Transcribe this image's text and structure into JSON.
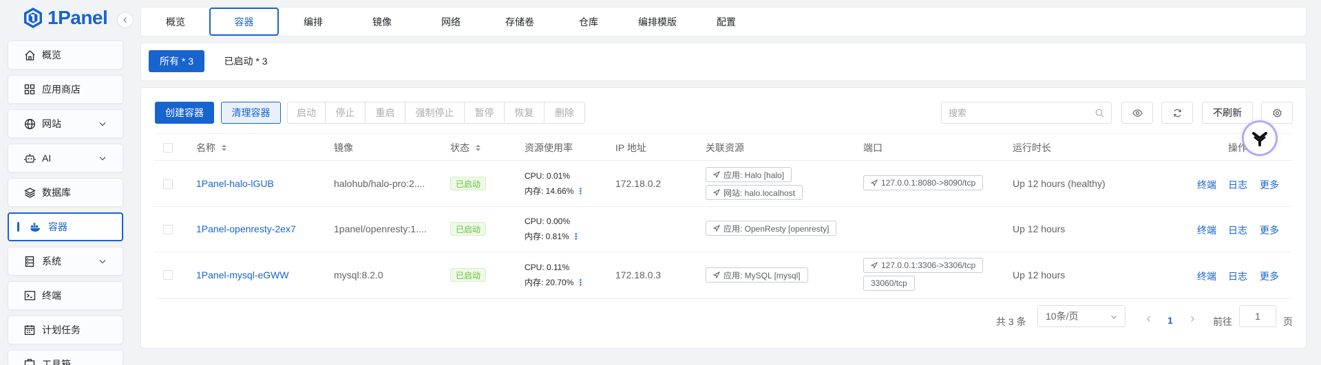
{
  "app": {
    "logo_text": "1Panel",
    "accent": "#1764cf"
  },
  "sidebar": {
    "items": [
      {
        "label": "概览",
        "icon": "home-icon"
      },
      {
        "label": "应用商店",
        "icon": "grid-icon"
      },
      {
        "label": "网站",
        "icon": "globe-icon",
        "expandable": true
      },
      {
        "label": "AI",
        "icon": "robot-icon",
        "expandable": true
      },
      {
        "label": "数据库",
        "icon": "layers-icon"
      },
      {
        "label": "容器",
        "icon": "docker-icon",
        "active": true
      },
      {
        "label": "系统",
        "icon": "server-icon",
        "expandable": true
      },
      {
        "label": "终端",
        "icon": "terminal-icon"
      },
      {
        "label": "计划任务",
        "icon": "calendar-icon"
      },
      {
        "label": "工具箱",
        "icon": "toolbox-icon"
      }
    ]
  },
  "tabs": [
    "概览",
    "容器",
    "编排",
    "镜像",
    "网络",
    "存储卷",
    "仓库",
    "编排模版",
    "配置"
  ],
  "active_tab": "容器",
  "filters": {
    "all": "所有 * 3",
    "running": "已启动 * 3"
  },
  "toolbar": {
    "create": "创建容器",
    "clean": "清理容器",
    "group": [
      "启动",
      "停止",
      "重启",
      "强制停止",
      "暂停",
      "恢复",
      "删除"
    ],
    "search_placeholder": "搜索",
    "no_refresh": "不刷新"
  },
  "table": {
    "headers": [
      "名称",
      "镜像",
      "状态",
      "资源使用率",
      "IP 地址",
      "关联资源",
      "端口",
      "运行时长",
      "操作"
    ],
    "rows": [
      {
        "name": "1Panel-halo-lGUB",
        "image": "halohub/halo-pro:2....",
        "status": "已启动",
        "cpu": "CPU: 0.01%",
        "mem": "内存: 14.66%",
        "ip": "172.18.0.2",
        "resources": [
          "应用: Halo [halo]",
          "网站: halo.localhost"
        ],
        "ports": [
          "127.0.0.1:8080->8090/tcp"
        ],
        "uptime": "Up 12 hours (healthy)"
      },
      {
        "name": "1Panel-openresty-2ex7",
        "image": "1panel/openresty:1....",
        "status": "已启动",
        "cpu": "CPU: 0.00%",
        "mem": "内存: 0.81%",
        "ip": "",
        "resources": [
          "应用: OpenResty [openresty]"
        ],
        "ports": [],
        "uptime": "Up 12 hours"
      },
      {
        "name": "1Panel-mysql-eGWW",
        "image": "mysql:8.2.0",
        "status": "已启动",
        "cpu": "CPU: 0.11%",
        "mem": "内存: 20.70%",
        "ip": "172.18.0.3",
        "resources": [
          "应用: MySQL [mysql]"
        ],
        "ports": [
          "127.0.0.1:3306->3306/tcp",
          "33060/tcp"
        ],
        "uptime": "Up 12 hours"
      }
    ],
    "actions": [
      "终端",
      "日志",
      "更多"
    ]
  },
  "pagination": {
    "total": "共 3 条",
    "page_size": "10条/页",
    "current": "1",
    "goto_label": "前往",
    "goto_value": "1",
    "page_suffix": "页"
  }
}
